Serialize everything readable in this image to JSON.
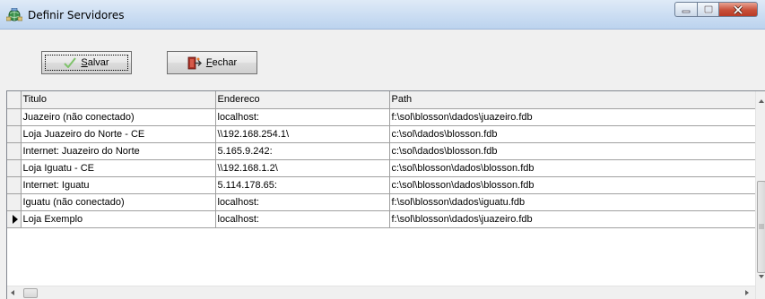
{
  "window": {
    "title": "Definir Servidores",
    "icon": "network-globe-icon"
  },
  "toolbar": {
    "save_label": "Salvar",
    "save_icon": "checkmark-icon",
    "close_label": "Fechar",
    "close_icon": "exit-door-icon"
  },
  "grid": {
    "columns": [
      "Titulo",
      "Endereco",
      "Path"
    ],
    "rows": [
      {
        "titulo": "Juazeiro (não conectado)",
        "endereco": "localhost:",
        "path": "f:\\sol\\blosson\\dados\\juazeiro.fdb"
      },
      {
        "titulo": "Loja Juazeiro do Norte - CE",
        "endereco": "\\\\192.168.254.1\\",
        "path": "c:\\sol\\dados\\blosson.fdb"
      },
      {
        "titulo": "Internet: Juazeiro do Norte",
        "endereco": "5.165.9.242:",
        "path": "c:\\sol\\dados\\blosson.fdb"
      },
      {
        "titulo": "Loja Iguatu - CE",
        "endereco": "\\\\192.168.1.2\\",
        "path": "c:\\sol\\blosson\\dados\\blosson.fdb"
      },
      {
        "titulo": "Internet: Iguatu",
        "endereco": "5.114.178.65:",
        "path": "c:\\sol\\blosson\\dados\\blosson.fdb"
      },
      {
        "titulo": "Iguatu (não conectado)",
        "endereco": "localhost:",
        "path": "f:\\sol\\blosson\\dados\\iguatu.fdb"
      },
      {
        "titulo": "Loja Exemplo",
        "endereco": "localhost:",
        "path": "f:\\sol\\blosson\\dados\\juazeiro.fdb"
      }
    ],
    "current_row_index": 6
  },
  "colors": {
    "titlebar": "#c9dcf2",
    "close_button": "#c8503a",
    "grid_lines": "#a0a0a0"
  }
}
